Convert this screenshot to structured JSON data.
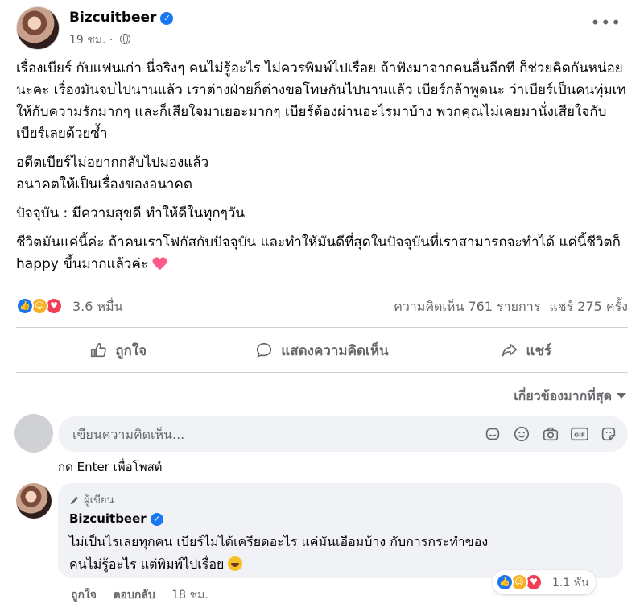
{
  "post": {
    "author": "Bizcuitbeer",
    "time": "19 ชม.",
    "paragraphs": [
      "เรื่องเบียร์ กับแฟนเก่า นี่จริงๆ คนไม่รู้อะไร ไม่ควรพิมพ์ไปเรื่อย ถ้าฟังมาจากคนอื่นอีกที ก็ช่วยคิดกันหน่อยนะคะ เรื่องมันจบไปนานแล้ว เราต่างฝ่ายก็ต่างขอโทษกันไปนานแล้ว เบียร์กล้าพูดนะ ว่าเบียร์เป็นคนทุ่มเทให้กับความรักมากๆ และก็เสียใจมาเยอะมากๆ เบียร์ต้องผ่านอะไรมาบ้าง พวกคุณไม่เคยมานั่งเสียใจกับเบียร์เลยด้วยซ้ำ",
      "อดีตเบียร์ไม่อยากกลับไปมองแล้ว",
      "อนาคตให้เป็นเรื่องของอนาคต",
      "ปัจจุบัน : มีความสุขดี ทำให้ดีในทุกๆวัน",
      "ชีวิตมันแค่นี้ค่ะ ถ้าคนเราโฟกัสกับปัจจุบัน และทำให้มันดีที่สุดในปัจจุบันที่เราสามารถจะทำได้ แค่นี้ชีวิตก็ happy ขึ้นมากแล้วค่ะ"
    ],
    "reaction_count": "3.6 หมื่น",
    "comments_count": "ความคิดเห็น 761 รายการ",
    "shares_count": "แชร์ 275 ครั้ง",
    "actions": {
      "like": "ถูกใจ",
      "comment": "แสดงความคิดเห็น",
      "share": "แชร์"
    }
  },
  "comments_section": {
    "sort_label": "เกี่ยวข้องมากที่สุด",
    "composer_placeholder": "เขียนความคิดเห็น...",
    "composer_icons": [
      "sticker-icon",
      "emoji-icon",
      "camera-icon",
      "gif-icon",
      "sticker-face-icon"
    ],
    "hint": "กด Enter เพื่อโพสต์"
  },
  "comment": {
    "badge": "ผู้เขียน",
    "author": "Bizcuitbeer",
    "text_line1": "ไม่เป็นไรเลยทุกคน เบียร์ไม่ได้เครียดอะไร แค่มันเอือมบ้าง กับการกระทำของ",
    "text_line2": "คนไม่รู้อะไร แต่พิมพ์ไปเรื่อย",
    "reaction_count": "1.1 พัน",
    "like": "ถูกใจ",
    "reply": "ตอบกลับ",
    "time": "18 ชม."
  },
  "colors": {
    "accent": "#1877f2",
    "love": "#f33e58",
    "care": "#f7b125",
    "secondary_text": "#65676b"
  }
}
